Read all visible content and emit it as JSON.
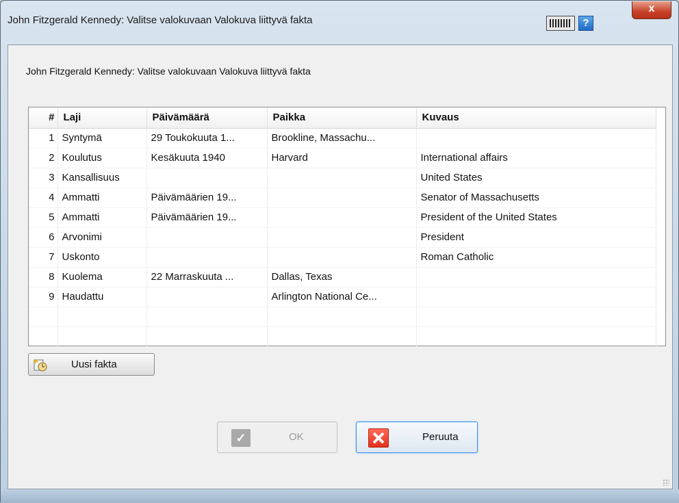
{
  "window": {
    "title": "John Fitzgerald Kennedy: Valitse valokuvaan Valokuva liittyvä fakta",
    "close_label": "x",
    "help_label": "?"
  },
  "dialog": {
    "heading": "John Fitzgerald Kennedy: Valitse valokuvaan Valokuva liittyvä fakta"
  },
  "table": {
    "columns": [
      "#",
      "Laji",
      "Päivämäärä",
      "Paikka",
      "Kuvaus"
    ],
    "rows": [
      [
        "1",
        "Syntymä",
        "29 Toukokuuta 1...",
        "Brookline, Massachu...",
        ""
      ],
      [
        "2",
        "Koulutus",
        "Kesäkuuta 1940",
        "Harvard",
        "International affairs"
      ],
      [
        "3",
        "Kansallisuus",
        "",
        "",
        "United States"
      ],
      [
        "4",
        "Ammatti",
        "Päivämäärien 19...",
        "",
        "Senator of Massachusetts"
      ],
      [
        "5",
        "Ammatti",
        "Päivämäärien 19...",
        "",
        "President of the United States"
      ],
      [
        "6",
        "Arvonimi",
        "",
        "",
        "President"
      ],
      [
        "7",
        "Uskonto",
        "",
        "",
        "Roman Catholic"
      ],
      [
        "8",
        "Kuolema",
        "22 Marraskuuta ...",
        "Dallas, Texas",
        ""
      ],
      [
        "9",
        "Haudattu",
        "",
        "Arlington National Ce...",
        ""
      ]
    ]
  },
  "buttons": {
    "new_fact": "Uusi fakta",
    "ok": "OK",
    "cancel": "Peruuta"
  }
}
